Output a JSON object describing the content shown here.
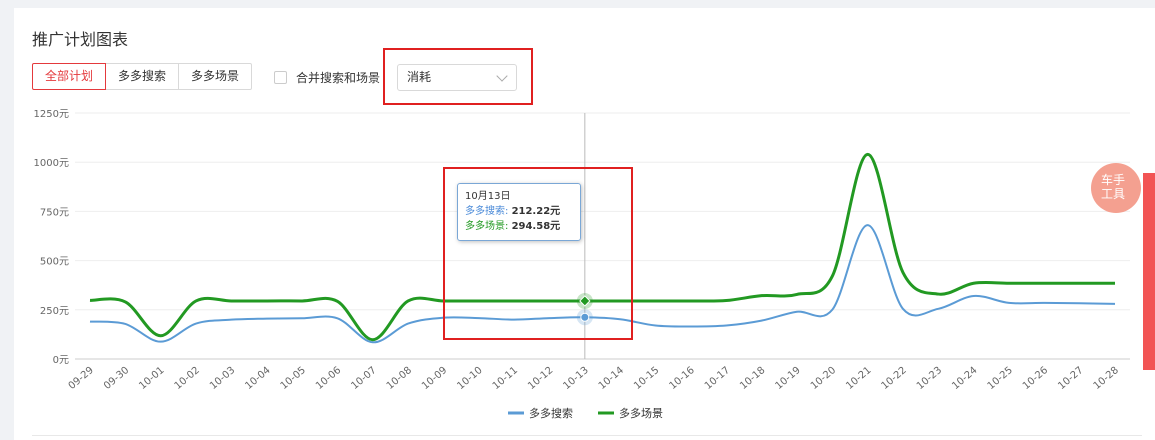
{
  "header": {
    "title": "推广计划图表"
  },
  "filters": {
    "buttons": [
      "全部计划",
      "多多搜索",
      "多多场景"
    ],
    "merge_label": "合并搜索和场景",
    "metric_select": "消耗"
  },
  "tooltip": {
    "date": "10月13日",
    "s1_label": "多多搜索",
    "s1_value": "212.22元",
    "s2_label": "多多场景",
    "s2_value": "294.58元"
  },
  "float_tool": {
    "line1": "车手",
    "line2": "工具"
  },
  "colors": {
    "accent": "#e4393c",
    "search": "#5b9bd5",
    "scene": "#229922"
  },
  "chart_data": {
    "type": "line",
    "x": [
      "09-29",
      "09-30",
      "10-01",
      "10-02",
      "10-03",
      "10-04",
      "10-05",
      "10-06",
      "10-07",
      "10-08",
      "10-09",
      "10-10",
      "10-11",
      "10-12",
      "10-13",
      "10-14",
      "10-15",
      "10-16",
      "10-17",
      "10-18",
      "10-19",
      "10-20",
      "10-21",
      "10-22",
      "10-23",
      "10-24",
      "10-25",
      "10-26",
      "10-27",
      "10-28"
    ],
    "y_ticks": [
      "0元",
      "250元",
      "500元",
      "750元",
      "1000元",
      "1250元"
    ],
    "ylim": [
      0,
      1250
    ],
    "series": [
      {
        "name": "多多搜索",
        "color": "#5b9bd5",
        "values": [
          190,
          178,
          88,
          180,
          200,
          205,
          207,
          207,
          85,
          180,
          210,
          208,
          200,
          208,
          212,
          202,
          170,
          165,
          170,
          195,
          240,
          250,
          680,
          255,
          255,
          320,
          285,
          285,
          283,
          280
        ]
      },
      {
        "name": "多多场景",
        "color": "#229922",
        "values": [
          298,
          290,
          118,
          295,
          295,
          295,
          295,
          293,
          98,
          295,
          295,
          295,
          295,
          295,
          295,
          295,
          295,
          295,
          297,
          322,
          328,
          420,
          1040,
          440,
          330,
          385,
          385,
          385,
          385,
          385
        ]
      }
    ],
    "legend_position": "bottom",
    "grid": true
  }
}
